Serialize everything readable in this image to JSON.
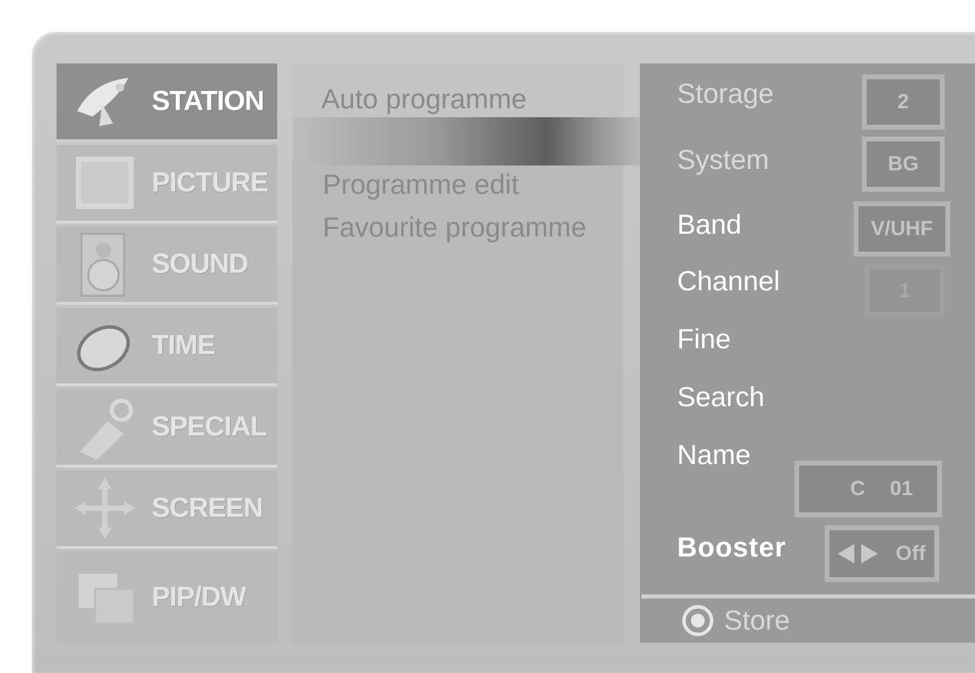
{
  "menu": {
    "items": [
      {
        "label": "STATION",
        "icon": "satellite-dish-icon",
        "active": true
      },
      {
        "label": "PICTURE",
        "icon": "tv-icon",
        "active": false
      },
      {
        "label": "SOUND",
        "icon": "speaker-icon",
        "active": false
      },
      {
        "label": "TIME",
        "icon": "clock-icon",
        "active": false
      },
      {
        "label": "SPECIAL",
        "icon": "tag-icon",
        "active": false
      },
      {
        "label": "SCREEN",
        "icon": "move-arrows-icon",
        "active": false
      },
      {
        "label": "PIP/DW",
        "icon": "pip-windows-icon",
        "active": false
      }
    ]
  },
  "submenu": {
    "items": [
      {
        "label": "Auto programme"
      },
      {
        "label": "Programme edit"
      },
      {
        "label": "Favourite programme"
      }
    ]
  },
  "settings": {
    "storage": {
      "label": "Storage",
      "value": "2"
    },
    "system": {
      "label": "System",
      "value": "BG"
    },
    "band": {
      "label": "Band",
      "value": "V/UHF"
    },
    "channel": {
      "label": "Channel",
      "value": "1"
    },
    "fine": {
      "label": "Fine"
    },
    "search": {
      "label": "Search"
    },
    "name": {
      "label": "Name",
      "value_prefix": "C",
      "value_number": "01"
    },
    "booster": {
      "label": "Booster",
      "value": "Off",
      "icon": "left-right-arrows-icon"
    }
  },
  "footer": {
    "icon": "ok-button-icon",
    "label": "Store"
  },
  "colors": {
    "panel": "#9a9a9a",
    "active_menu": "#8f8f8f",
    "text_light": "#ffffff"
  }
}
